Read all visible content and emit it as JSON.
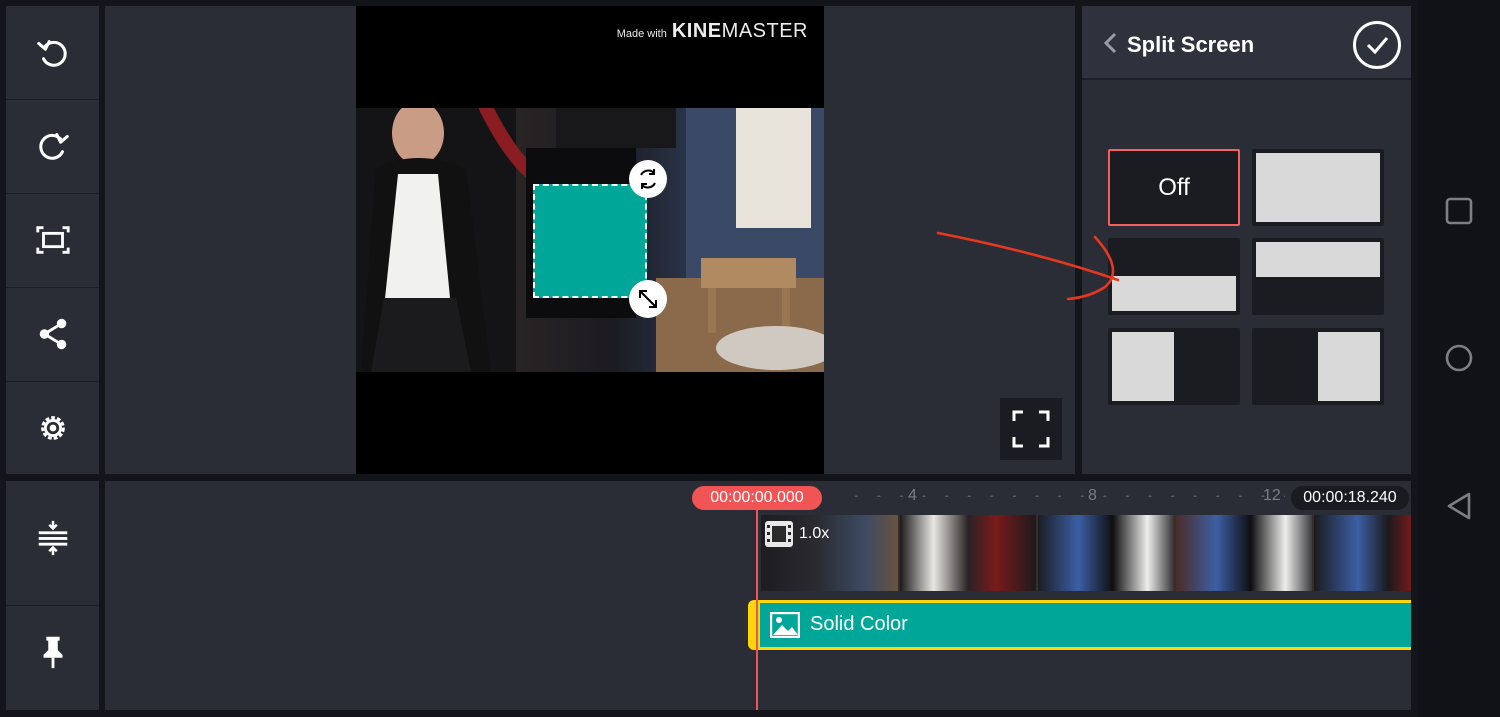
{
  "toolbar": {
    "items": [
      {
        "name": "undo-button",
        "icon": "undo-icon"
      },
      {
        "name": "redo-button",
        "icon": "redo-icon"
      },
      {
        "name": "screen-capture-button",
        "icon": "capture-frame-icon"
      },
      {
        "name": "share-button",
        "icon": "share-icon"
      },
      {
        "name": "settings-button",
        "icon": "gear-icon"
      }
    ],
    "bottom_items": [
      {
        "name": "expand-tracks-button",
        "icon": "expand-tracks-icon"
      },
      {
        "name": "pin-button",
        "icon": "pin-icon"
      }
    ]
  },
  "preview": {
    "watermark_prefix": "Made with",
    "watermark_brand_bold": "KINE",
    "watermark_brand_rest": "MASTER"
  },
  "split_panel": {
    "title": "Split Screen",
    "off_label": "Off",
    "options": [
      "off",
      "full",
      "bottom-half",
      "top-half",
      "left-half",
      "right-half"
    ],
    "selected": "off",
    "accent_color": "#f26060"
  },
  "timeline": {
    "current_time": "00:00:00.000",
    "total_time": "00:00:18.240",
    "ticks": [
      "4",
      "8",
      "12"
    ],
    "video_speed": "1.0x",
    "solid_layer_label": "Solid Color",
    "solid_color": "#00a697",
    "selection_color": "#ffd60a",
    "playhead_color": "#f05454"
  },
  "nav": {
    "items": [
      "recent-apps-button",
      "home-button",
      "back-button"
    ]
  }
}
